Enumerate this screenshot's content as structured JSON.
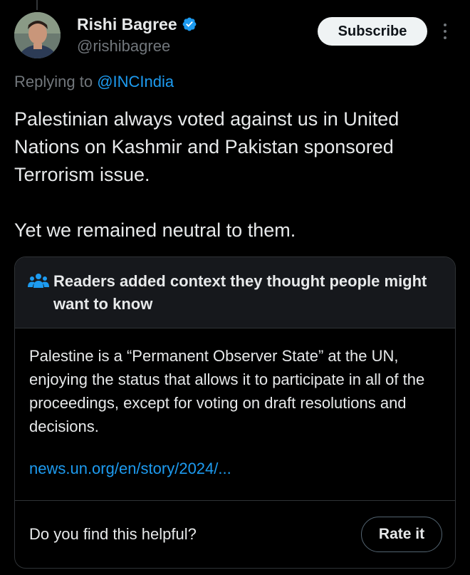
{
  "author": {
    "display_name": "Rishi Bagree",
    "handle": "@rishibagree",
    "verified": true,
    "verified_color": "#1d9bf0"
  },
  "actions": {
    "subscribe_label": "Subscribe",
    "more_icon": "more-vertical-icon"
  },
  "reply_context": {
    "prefix": "Replying to",
    "mention": "@INCIndia"
  },
  "tweet": {
    "paragraphs": [
      "Palestinian always voted against us in United Nations on Kashmir and Pakistan sponsored Terrorism issue.",
      "Yet we remained neutral to them."
    ]
  },
  "community_note": {
    "icon": "people-icon",
    "title": "Readers added context they thought people might want to know",
    "text": "Palestine is a “Permanent Observer State” at the UN, enjoying the status that allows it to participate in all of the proceedings, except for voting on draft resolutions and decisions.",
    "link": "news.un.org/en/story/2024/...",
    "helpful_question": "Do you find this helpful?",
    "rate_label": "Rate it"
  },
  "colors": {
    "background": "#000000",
    "text": "#e7e9ea",
    "secondary": "#71767b",
    "accent": "#1d9bf0",
    "note_header_bg": "#16181c",
    "border": "#2f3336"
  }
}
